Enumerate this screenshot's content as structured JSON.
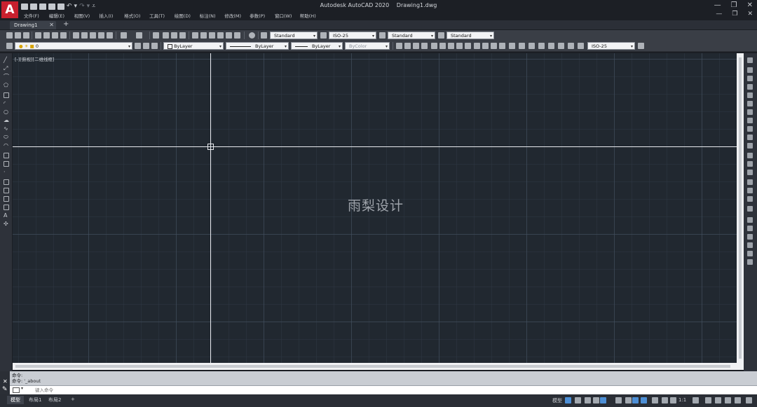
{
  "app": {
    "logo_letter": "A",
    "title": "Autodesk AutoCAD 2020",
    "filename": "Drawing1.dwg"
  },
  "menu": [
    "文件(F)",
    "编辑(E)",
    "视图(V)",
    "插入(I)",
    "格式(O)",
    "工具(T)",
    "绘图(D)",
    "标注(N)",
    "修改(M)",
    "参数(P)",
    "窗口(W)",
    "帮助(H)"
  ],
  "window_controls": {
    "minimize": "—",
    "restore": "❐",
    "close": "✕"
  },
  "tabs": {
    "document": "Drawing1",
    "close": "✕",
    "new": "+"
  },
  "styles_toolbar": {
    "text_style": "Standard",
    "dim_style": "ISO-25",
    "table_style": "Standard",
    "mleader_style": "Standard"
  },
  "layers_toolbar": {
    "layer": "0",
    "color": "ByLayer",
    "linetype": "ByLayer",
    "lineweight": "ByLayer",
    "plot_style": "ByColor",
    "dim_style": "ISO-25"
  },
  "viewport": {
    "label": "[-][俯视][二维线框]",
    "watermark": "雨梨设计"
  },
  "command": {
    "history_1": "命令:",
    "history_2": "命令: '_about",
    "placeholder": "键入命令"
  },
  "layout_tabs": [
    "模型",
    "布局1",
    "布局2"
  ],
  "layout_add": "+",
  "status": {
    "model_label": "模型",
    "scale": "1:1",
    "accent_color": "#4d8fd6"
  }
}
